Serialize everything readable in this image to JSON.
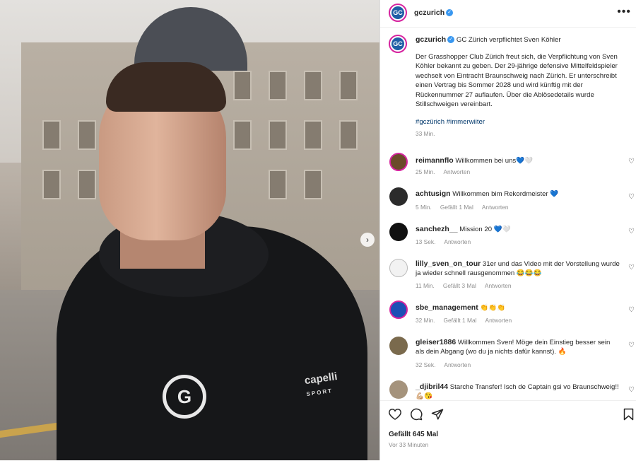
{
  "post": {
    "username": "gczurich",
    "caption_title": "GC Zürich verpflichtet Sven Köhler",
    "caption_body": "Der Grasshopper Club Zürich freut sich, die Verpflichtung von Sven Köhler bekannt zu geben. Der 29-jährige defensive Mittelfeldspieler wechselt von Eintracht Braunschweig nach Zürich. Er unterschreibt einen Vertrag bis Sommer 2028 und wird künftig mit der Rückennummer 27 auflaufen. Über die Ablösedetails wurde Stillschweigen vereinbart.",
    "hashtags": "#gczürich #immerwiiter",
    "caption_time": "33 Min.",
    "likes": "Gefällt 645 Mal",
    "posted_ago": "Vor 33 Minuten",
    "photo_brand_text": "capelli",
    "photo_brand_sub": "SPORT"
  },
  "comments": [
    {
      "user": "reimannflo",
      "text": "Willkommen bei uns💙🤍",
      "time": "25 Min.",
      "likes": "",
      "reply": "Antworten"
    },
    {
      "user": "achtusign",
      "text": "Willkommen bim Rekordmeister 💙",
      "time": "5 Min.",
      "likes": "Gefällt 1 Mal",
      "reply": "Antworten"
    },
    {
      "user": "sanchezh__",
      "text": "Mission 20 💙🤍",
      "time": "13 Sek.",
      "likes": "",
      "reply": "Antworten"
    },
    {
      "user": "lilly_sven_on_tour",
      "text": "31er und das Video mit der Vorstellung wurde ja wieder schnell rausgenommen 😂😂😂",
      "time": "11 Min.",
      "likes": "Gefällt 3 Mal",
      "reply": "Antworten"
    },
    {
      "user": "sbe_management",
      "text": "👏👏👏",
      "time": "32 Min.",
      "likes": "Gefällt 1 Mal",
      "reply": "Antworten"
    },
    {
      "user": "gleiser1886",
      "text": "Willkommen Sven! Möge dein Einstieg besser sein als dein Abgang (wo du ja nichts dafür kannst). 🔥",
      "time": "32 Sek.",
      "likes": "",
      "reply": "Antworten"
    },
    {
      "user": "_djibril44",
      "text": "Starche Transfer! Isch de Captain gsi vo Braunschweig!!💪🏼😘",
      "time": "",
      "likes": "",
      "reply": ""
    }
  ],
  "icons": {
    "more": "more-options-icon",
    "verified": "verified-badge-icon",
    "heart": "heart-icon",
    "comment": "comment-icon",
    "share": "share-icon",
    "save": "bookmark-icon",
    "next": "chevron-right-icon"
  },
  "colors": {
    "accent": "#3897f0",
    "text": "#262626",
    "muted": "#8e8e8e",
    "link": "#00376b"
  }
}
